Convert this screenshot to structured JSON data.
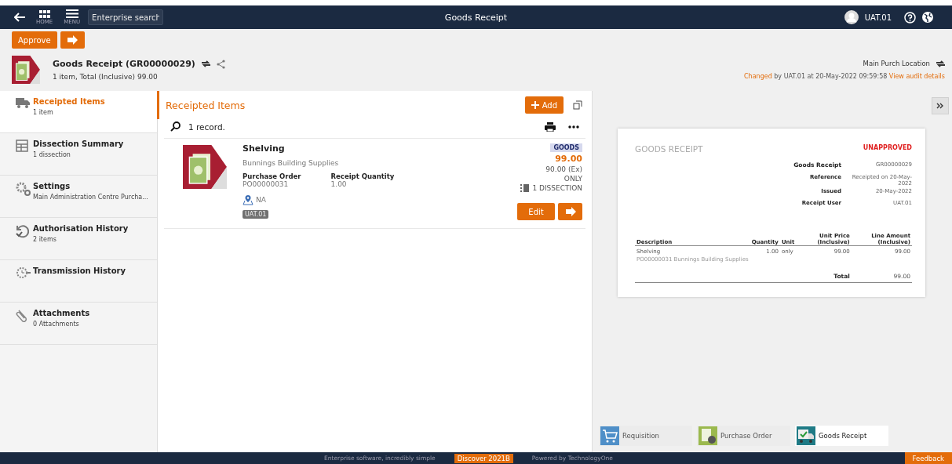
{
  "top_bar": {
    "home_label": "HOME",
    "menu_label": "MENU",
    "search": {
      "placeholder": "Enterprise search"
    },
    "title": "Goods Receipt",
    "user": "UAT.01"
  },
  "toolbar": {
    "approve": "Approve"
  },
  "header": {
    "title": "Goods Receipt (GR00000029)",
    "summary": "1 item, Total (Inclusive) 99.00",
    "location": "Main Purch Location",
    "changed": "Changed",
    "changed_by": "by UAT.01  at 20-May-2022 09:59:58",
    "audit_link": "View audit details"
  },
  "sidebar": {
    "items": [
      {
        "kind": "truck",
        "label": "Receipted Items",
        "sub": "1 item",
        "selected": true
      },
      {
        "kind": "table",
        "label": "Dissection Summary",
        "sub": "1 dissection",
        "selected": false
      },
      {
        "kind": "gears",
        "label": "Settings",
        "sub": "Main Administration Centre Purcha...",
        "selected": false
      },
      {
        "kind": "history",
        "label": "Authorisation History",
        "sub": "2 items",
        "selected": false
      },
      {
        "kind": "transmit",
        "label": "Transmission History",
        "selected": false
      },
      {
        "kind": "clip",
        "label": "Attachments",
        "sub": "0 Attachments",
        "selected": false
      }
    ]
  },
  "list": {
    "title": "Receipted Items",
    "add": "Add",
    "count": "1 record.",
    "items": [
      {
        "name": "Shelving",
        "supplier": "Bunnings Building Supplies",
        "po_label": "Purchase Order",
        "po": "PO00000031",
        "qty_label": "Receipt Quantity",
        "qty": "1.00",
        "location": "NA",
        "user": "UAT.01",
        "badge": "GOODS",
        "amount": "99.00",
        "ex": "90.00 (Ex)",
        "unit": "ONLY",
        "dissection": "1 DISSECTION",
        "edit": "Edit"
      }
    ]
  },
  "preview": {
    "doc_title": "GOODS RECEIPT",
    "status": "UNAPPROVED",
    "fields": [
      {
        "label": "Goods Receipt",
        "value": "GR00000029"
      },
      {
        "label": "Reference",
        "value": "Receipted on 20-May-2022"
      },
      {
        "label": "Issued",
        "value": "20-May-2022"
      },
      {
        "label": "Receipt User",
        "value": "UAT.01"
      }
    ],
    "columns": [
      "Description",
      "Quantity",
      "Unit",
      "Unit Price (Inclusive)",
      "Line Amount (Inclusive)"
    ],
    "lines": [
      {
        "description": "Shelving",
        "detail": "PO00000031    Bunnings Building Supplies",
        "quantity": "1.00",
        "unit": "only",
        "price": "99.00",
        "amount": "99.00"
      }
    ],
    "total_label": "Total",
    "total": "99.00"
  },
  "doc_tabs": [
    {
      "kind": "cart",
      "label": "Requisition",
      "selected": false
    },
    {
      "kind": "po",
      "label": "Purchase Order",
      "selected": false
    },
    {
      "kind": "truck",
      "label": "Goods Receipt",
      "selected": true
    }
  ],
  "footer": {
    "tagline": "Enterprise software, incredibly simple",
    "badge": "Discover 2021B",
    "powered": "Powered by TechnologyOne",
    "feedback": "Feedback"
  }
}
